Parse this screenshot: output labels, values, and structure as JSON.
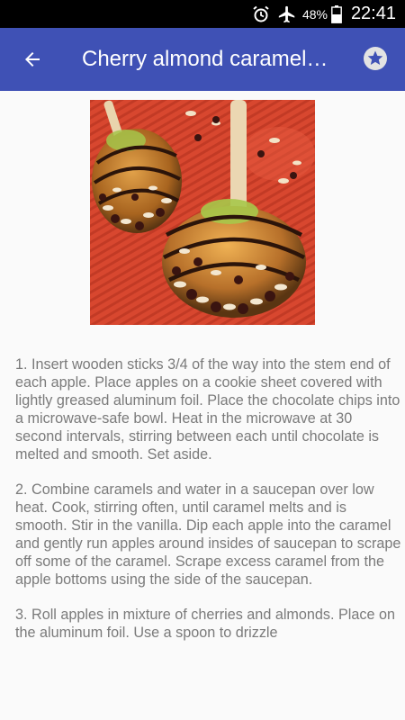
{
  "status_bar": {
    "battery_percent": "48%",
    "time": "22:41",
    "icons": [
      "alarm-icon",
      "airplane-mode-icon",
      "battery-icon"
    ]
  },
  "app_bar": {
    "title": "Cherry almond caramel…",
    "back_icon": "arrow-back-icon",
    "favorite_icon": "star-icon",
    "color": "#3f51b5"
  },
  "recipe": {
    "image_alt": "Caramel apples with chocolate drizzle, cherries and almonds",
    "steps": [
      "1. Insert wooden sticks 3/4 of the way into the stem end of each apple. Place apples on a cookie sheet covered with lightly greased aluminum foil. Place the chocolate chips into a microwave-safe bowl. Heat in the microwave at 30 second intervals, stirring between each until chocolate is melted and smooth. Set aside.",
      "2. Combine caramels and water in a saucepan over low heat. Cook, stirring often, until caramel melts and is smooth. Stir in the vanilla. Dip each apple into the caramel and gently run apples around insides of saucepan to scrape off some of the caramel. Scrape excess caramel from the apple bottoms using the side of the saucepan.",
      "3. Roll apples in mixture of cherries and almonds. Place on the aluminum foil. Use a spoon to drizzle"
    ]
  }
}
